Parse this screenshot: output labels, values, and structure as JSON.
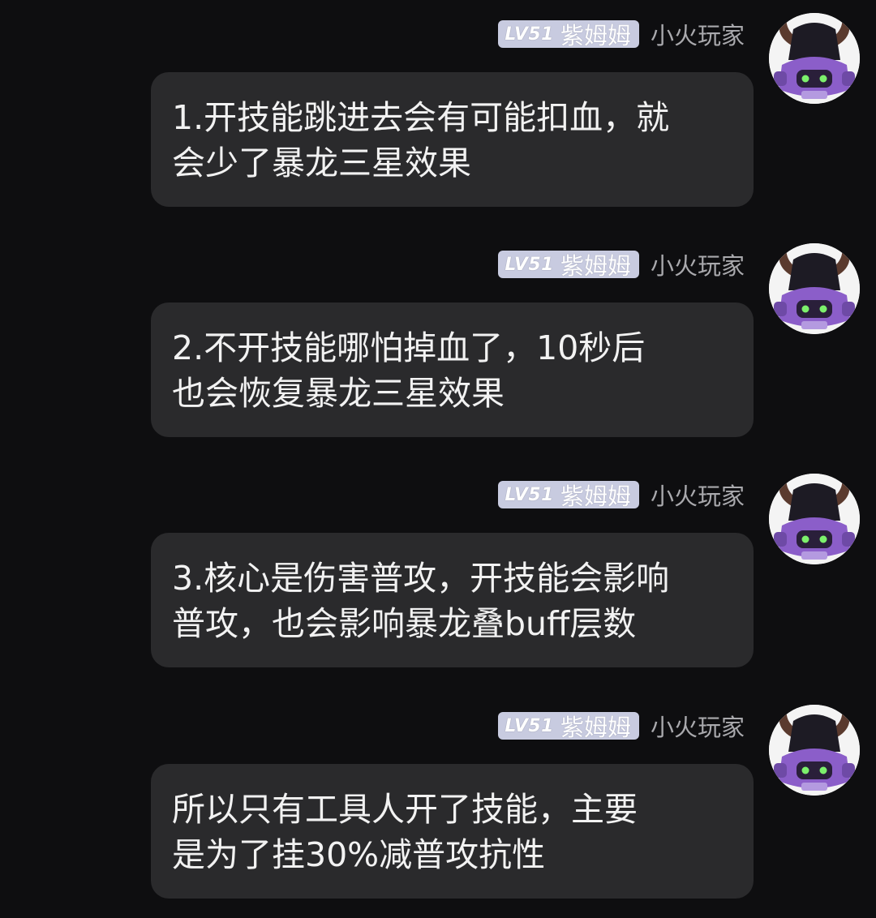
{
  "messages": [
    {
      "level": "LV51",
      "nickname": "紫姆姆",
      "role": "小火玩家",
      "avatar_icon": "horned-robot-avatar",
      "text": "1.开技能跳进去会有可能扣血，就\n会少了暴龙三星效果"
    },
    {
      "level": "LV51",
      "nickname": "紫姆姆",
      "role": "小火玩家",
      "avatar_icon": "horned-robot-avatar",
      "text": "2.不开技能哪怕掉血了，10秒后\n也会恢复暴龙三星效果"
    },
    {
      "level": "LV51",
      "nickname": "紫姆姆",
      "role": "小火玩家",
      "avatar_icon": "horned-robot-avatar",
      "text": "3.核心是伤害普攻，开技能会影响\n普攻，也会影响暴龙叠buff层数"
    },
    {
      "level": "LV51",
      "nickname": "紫姆姆",
      "role": "小火玩家",
      "avatar_icon": "horned-robot-avatar",
      "text": "所以只有工具人开了技能，主要\n是为了挂30%减普攻抗性"
    }
  ],
  "colors": {
    "background": "#0e0e10",
    "bubble": "#2a2a2c",
    "badge": "#c8cbe0",
    "role_text": "#a9a9ad",
    "avatar_purple": "#8b5ec9"
  }
}
